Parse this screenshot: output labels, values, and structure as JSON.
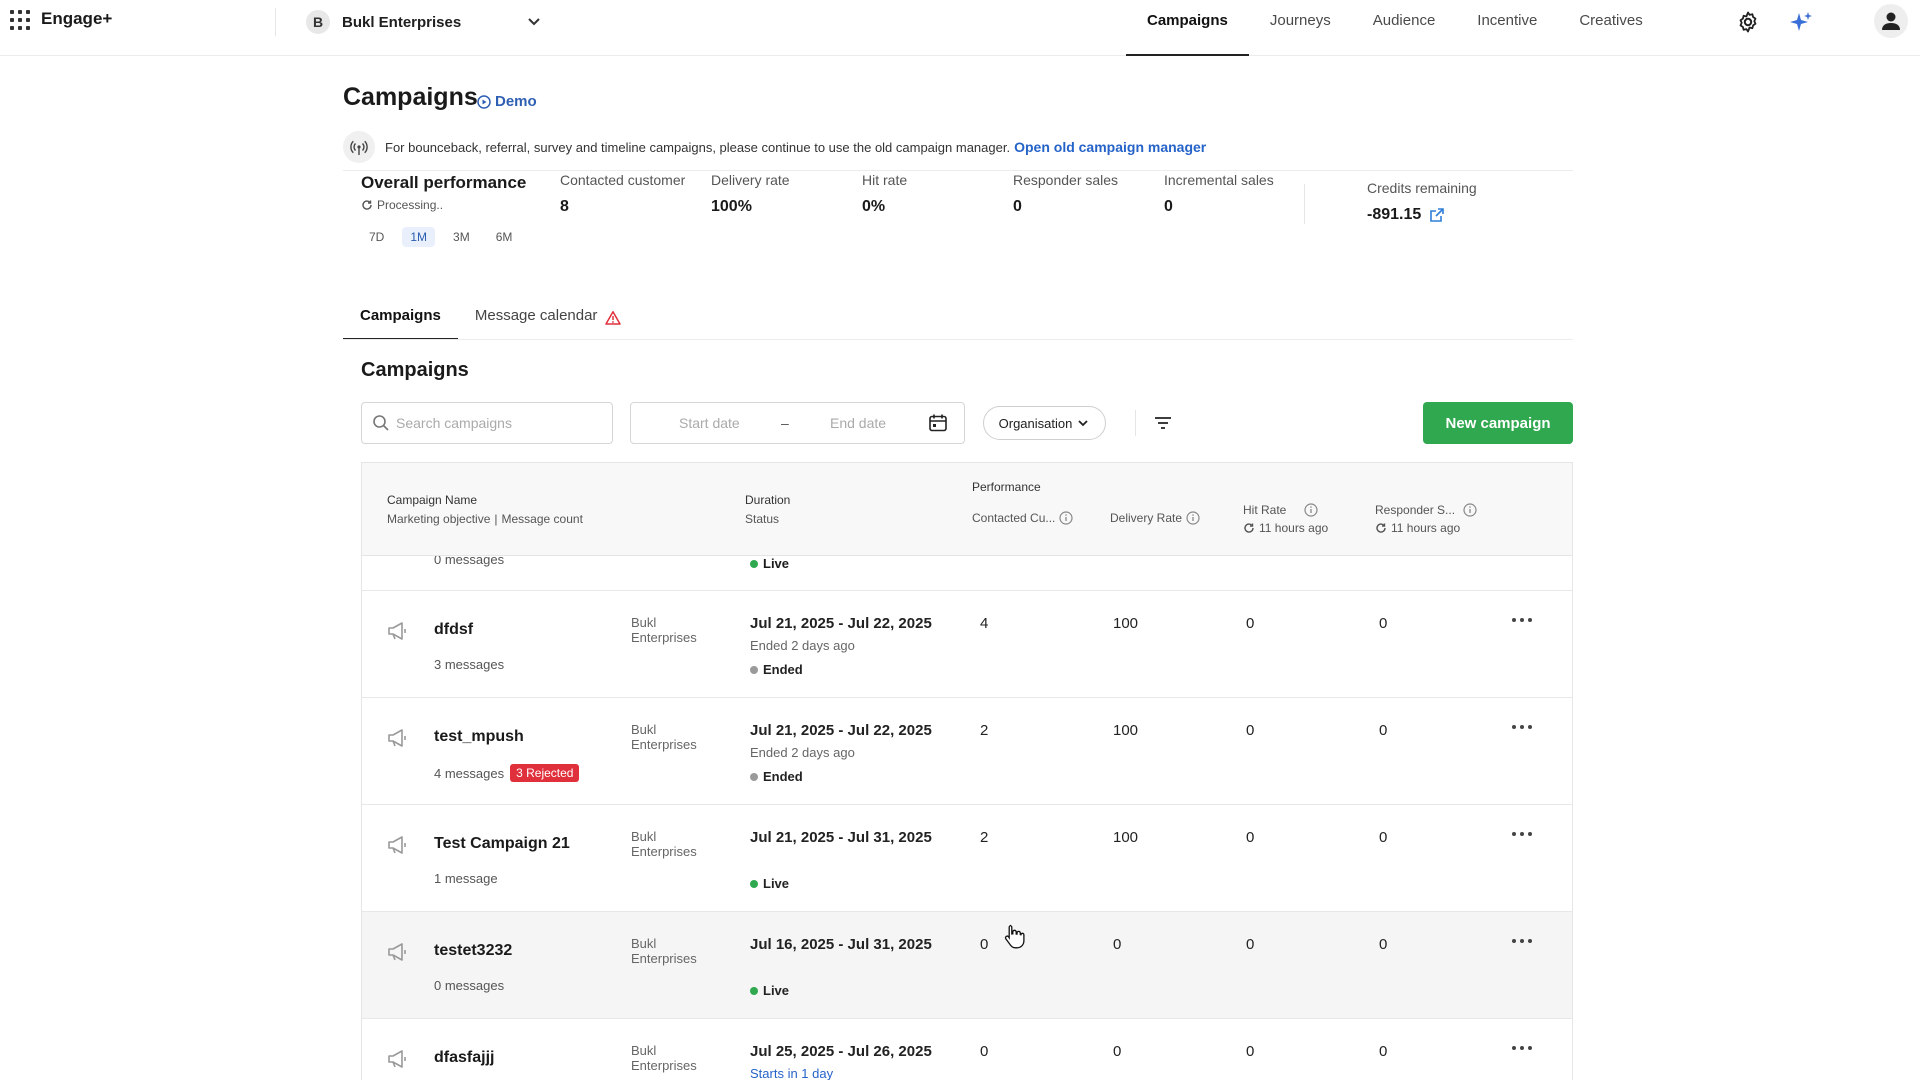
{
  "app": {
    "brand": "Engage+"
  },
  "org": {
    "initial": "B",
    "name": "Bukl Enterprises"
  },
  "nav": {
    "tabs": [
      "Campaigns",
      "Journeys",
      "Audience",
      "Incentive",
      "Creatives"
    ],
    "active": "Campaigns"
  },
  "header": {
    "title": "Campaigns",
    "demo_label": "Demo"
  },
  "notice": {
    "text": "For bounceback, referral, survey and timeline campaigns, please continue to use the old campaign manager.",
    "link": "Open old campaign manager"
  },
  "performance": {
    "title": "Overall performance",
    "processing": "Processing..",
    "ranges": [
      "7D",
      "1M",
      "3M",
      "6M"
    ],
    "active_range": "1M",
    "metrics": [
      {
        "label": "Contacted customer",
        "value": "8"
      },
      {
        "label": "Delivery rate",
        "value": "100%"
      },
      {
        "label": "Hit rate",
        "value": "0%"
      },
      {
        "label": "Responder sales",
        "value": "0"
      },
      {
        "label": "Incremental sales",
        "value": "0"
      }
    ],
    "credits": {
      "label": "Credits remaining",
      "value": "-891.15"
    }
  },
  "subtabs": {
    "campaigns": "Campaigns",
    "calendar": "Message calendar"
  },
  "section": {
    "title": "Campaigns"
  },
  "toolbar": {
    "search_placeholder": "Search campaigns",
    "start_date": "Start date",
    "dash": "–",
    "end_date": "End date",
    "org_filter": "Organisation",
    "new_campaign": "New campaign"
  },
  "table": {
    "headers": {
      "name": "Campaign Name",
      "objective": "Marketing objective",
      "sep": "|",
      "msg_count": "Message count",
      "duration": "Duration",
      "status": "Status",
      "performance": "Performance",
      "contacted": "Contacted Cu...",
      "delivery": "Delivery Rate",
      "hit": "Hit Rate",
      "hit_sub": "11 hours ago",
      "responder": "Responder S...",
      "responder_sub": "11 hours ago"
    },
    "partial": {
      "msgs": "0 messages",
      "status": "Live"
    },
    "rows": [
      {
        "name": "dfdsf",
        "msgs": "3 messages",
        "rejected": "",
        "org1": "Bukl",
        "org2": "Enterprises",
        "duration": "Jul 21, 2025 - Jul 22, 2025",
        "substat": "Ended 2 days ago",
        "status": "Ended",
        "contacted": "4",
        "delivery": "100",
        "hit": "0",
        "responder": "0"
      },
      {
        "name": "test_mpush",
        "msgs": "4 messages",
        "rejected": "3 Rejected",
        "org1": "Bukl",
        "org2": "Enterprises",
        "duration": "Jul 21, 2025 - Jul 22, 2025",
        "substat": "Ended 2 days ago",
        "status": "Ended",
        "contacted": "2",
        "delivery": "100",
        "hit": "0",
        "responder": "0"
      },
      {
        "name": "Test Campaign 21",
        "msgs": "1 message",
        "rejected": "",
        "org1": "Bukl",
        "org2": "Enterprises",
        "duration": "Jul 21, 2025 - Jul 31, 2025",
        "substat": "",
        "status": "Live",
        "contacted": "2",
        "delivery": "100",
        "hit": "0",
        "responder": "0"
      },
      {
        "name": "testet3232",
        "msgs": "0 messages",
        "rejected": "",
        "org1": "Bukl",
        "org2": "Enterprises",
        "duration": "Jul 16, 2025 - Jul 31, 2025",
        "substat": "",
        "status": "Live",
        "contacted": "0",
        "delivery": "0",
        "hit": "0",
        "responder": "0"
      },
      {
        "name": "dfasfajjj",
        "msgs": "",
        "rejected": "",
        "org1": "Bukl",
        "org2": "Enterprises",
        "duration": "Jul 25, 2025 - Jul 26, 2025",
        "substat": "Starts in 1 day",
        "status": "",
        "contacted": "0",
        "delivery": "0",
        "hit": "0",
        "responder": "0"
      }
    ]
  },
  "colors": {
    "primary_green": "#2fa84f",
    "link_blue": "#2563c9",
    "rejected_red": "#e0303b",
    "warning_red": "#e0303b"
  }
}
